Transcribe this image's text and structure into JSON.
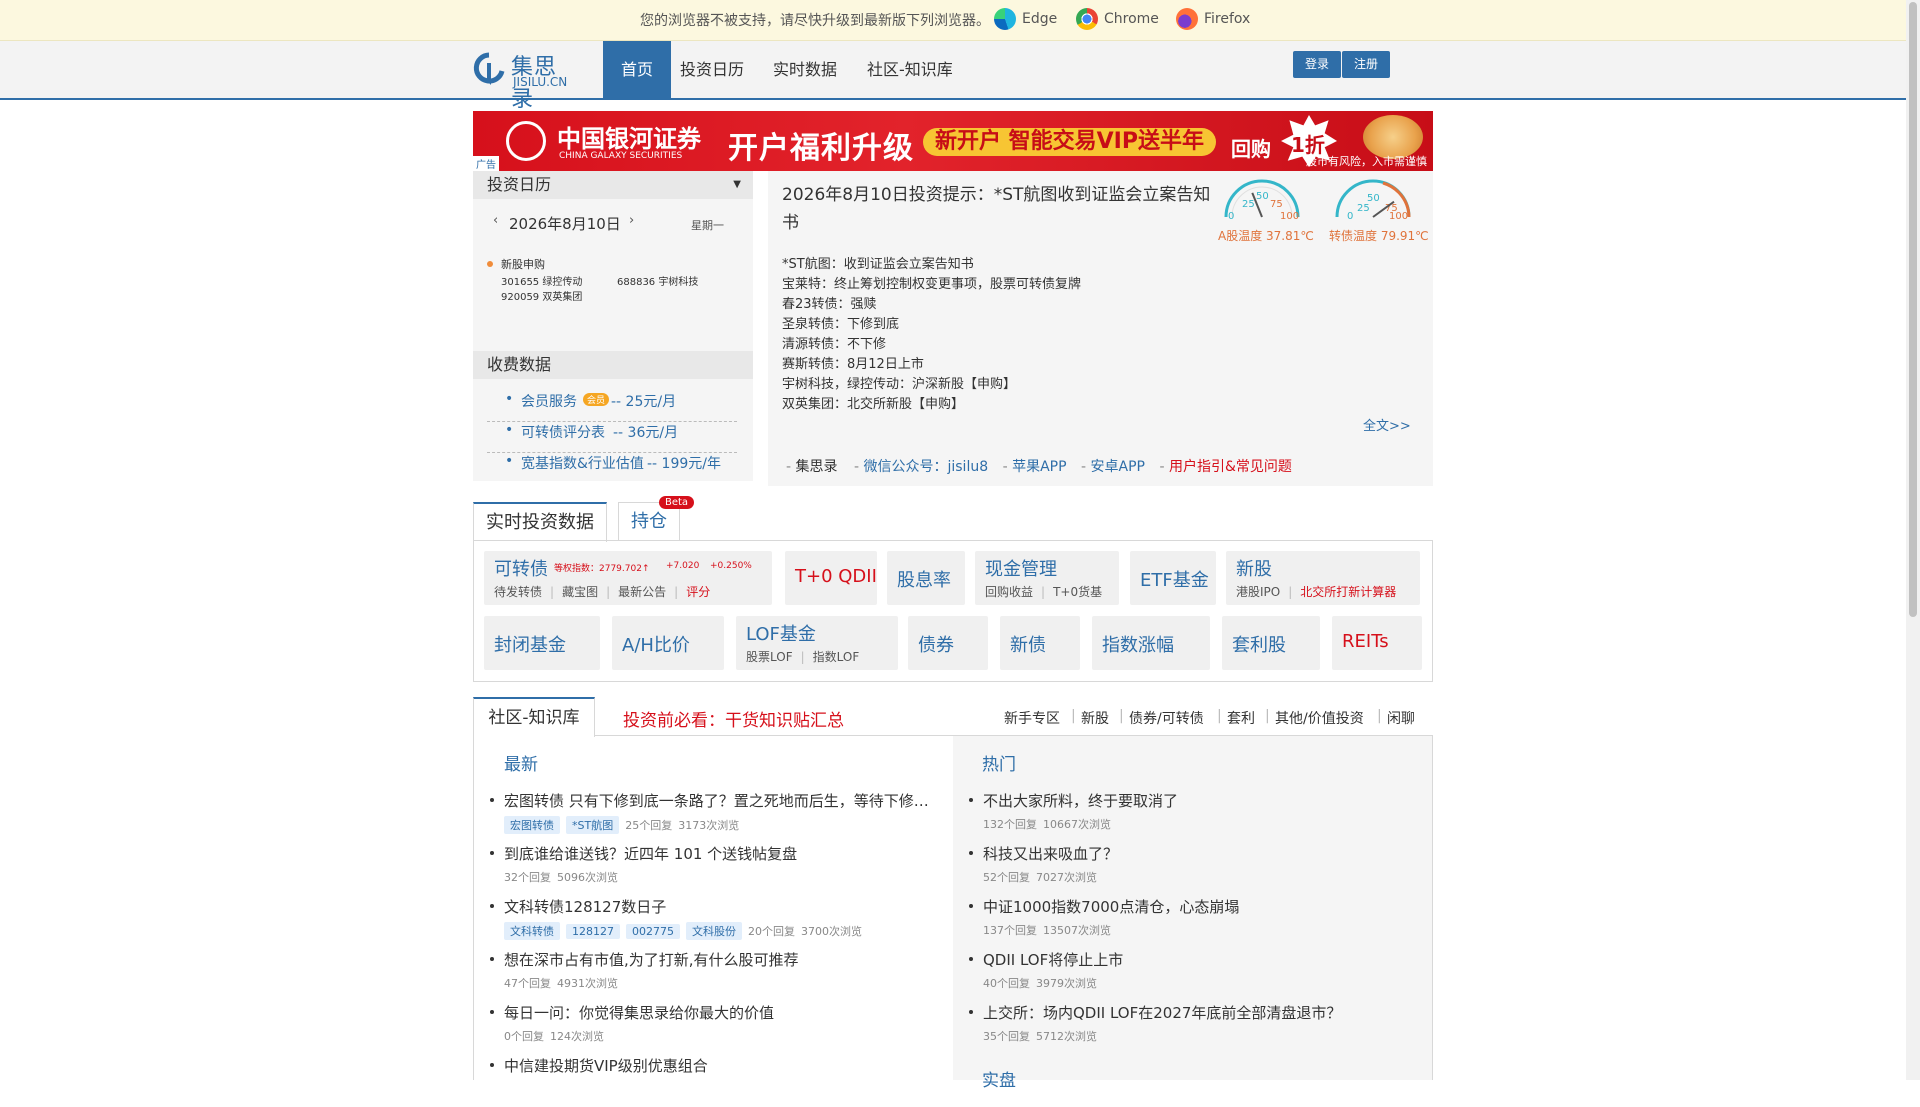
{
  "warning": {
    "message": "您的浏览器不被支持，请尽快升级到最新版下列浏览器。",
    "browsers": [
      "Edge",
      "Chrome",
      "Firefox"
    ]
  },
  "nav": {
    "logo_cn": "集思录",
    "logo_en": "JISILU.CN",
    "items": [
      "首页",
      "投资日历",
      "实时数据",
      "社区-知识库"
    ],
    "login": "登录",
    "register": "注册"
  },
  "banner": {
    "brand": "中国银河证券",
    "brand_en": "CHINA GALAXY SECURITIES",
    "slogan": "开户福利升级",
    "pill": "新开户 智能交易VIP送半年",
    "buyback": "回购",
    "burst": "1折",
    "risk": "股市有风险，入市需谨慎",
    "ad_label": "广告"
  },
  "calendar": {
    "title": "投资日历",
    "date": "2026年8月10日",
    "weekday": "星期一",
    "event_type": "新股申购",
    "stocks": [
      "301655 绿控传动",
      "688836 宇树科技",
      "920059 双英集团"
    ]
  },
  "paid": {
    "title": "收费数据",
    "items": [
      {
        "label": "会员服务",
        "badge": "会员",
        "price": "-- 25元/月"
      },
      {
        "label": "可转债评分表",
        "price": "-- 36元/月"
      },
      {
        "label": "宽基指数&行业估值",
        "price": "-- 199元/年"
      }
    ]
  },
  "tip": {
    "heading": "2026年8月10日投资提示：*ST航图收到证监会立案告知书",
    "lines": [
      "*ST航图：收到证监会立案告知书",
      "宝莱特：终止筹划控制权变更事项，股票可转债复牌",
      "春23转债：强赎",
      "圣泉转债：下修到底",
      "清源转债：不下修",
      "赛斯转债：8月12日上市",
      "宇树科技，绿控传动：沪深新股【申购】",
      "双英集团：北交所新股【申购】"
    ],
    "more": "全文>>",
    "gauges": [
      {
        "label": "A股温度 37.81℃",
        "value": 37.81,
        "ticks": [
          "0",
          "25",
          "50",
          "75",
          "100"
        ]
      },
      {
        "label": "转债温度 79.91℃",
        "value": 79.91,
        "ticks": [
          "0",
          "25",
          "50",
          "75",
          "100"
        ]
      }
    ],
    "links": [
      "集思录",
      "微信公众号：jisilu8",
      "苹果APP",
      "安卓APP",
      "用户指引&常见问题"
    ]
  },
  "realtime": {
    "tab_active": "实时投资数据",
    "tab2": "持仓",
    "tab2_badge": "Beta",
    "convertible": {
      "title": "可转债",
      "index_label": "等权指数：2779.702↑",
      "change": "+7.020",
      "pct": "+0.250%",
      "subs": [
        "待发转债",
        "藏宝图",
        "最新公告",
        "评分"
      ]
    },
    "qdii": "T+0 QDII",
    "dividend": "股息率",
    "cash": {
      "title": "现金管理",
      "subs": [
        "回购收益",
        "T+0货基"
      ]
    },
    "etf": "ETF基金",
    "ipo": {
      "title": "新股",
      "subs": [
        "港股IPO",
        "北交所打新计算器"
      ]
    },
    "row2": [
      "封闭基金",
      "A/H比价",
      "债券",
      "新债",
      "指数涨幅",
      "套利股",
      "REITs"
    ],
    "lof": {
      "title": "LOF基金",
      "subs": [
        "股票LOF",
        "指数LOF"
      ]
    }
  },
  "community": {
    "tab": "社区-知识库",
    "notice": "投资前必看：干货知识贴汇总",
    "categories": [
      "新手专区",
      "新股",
      "债券/可转债",
      "套利",
      "其他/价值投资",
      "闲聊"
    ],
    "latest_title": "最新",
    "latest": [
      {
        "title": "宏图转债 只有下修到底一条路了？置之死地而后生，等待下修…",
        "tags": [
          "宏图转债",
          "*ST航图"
        ],
        "meta": [
          "25个回复",
          "3173次浏览"
        ]
      },
      {
        "title": "到底谁给谁送钱？近四年 101 个送钱帖复盘",
        "tags": [],
        "meta": [
          "32个回复",
          "5096次浏览"
        ]
      },
      {
        "title": "文科转债128127数日子",
        "tags": [
          "文科转债",
          "128127",
          "002775",
          "文科股份"
        ],
        "meta": [
          "20个回复",
          "3700次浏览"
        ]
      },
      {
        "title": "想在深市占有市值,为了打新,有什么股可推荐",
        "tags": [],
        "meta": [
          "47个回复",
          "4931次浏览"
        ]
      },
      {
        "title": "每日一问：你觉得集思录给你最大的价值",
        "tags": [],
        "meta": [
          "0个回复",
          "124次浏览"
        ]
      },
      {
        "title": "中信建投期货VIP级别优惠组合",
        "tags": [],
        "meta": []
      }
    ],
    "hot_title": "热门",
    "hot": [
      {
        "title": "不出大家所料，终于要取消了",
        "meta": [
          "132个回复",
          "10667次浏览"
        ]
      },
      {
        "title": "科技又出来吸血了？",
        "meta": [
          "52个回复",
          "7027次浏览"
        ]
      },
      {
        "title": "中证1000指数7000点清仓，心态崩塌",
        "meta": [
          "137个回复",
          "13507次浏览"
        ]
      },
      {
        "title": "QDII LOF将停止上市",
        "meta": [
          "40个回复",
          "3979次浏览"
        ]
      },
      {
        "title": "上交所：场内QDII LOF在2027年底前全部清盘退市？",
        "meta": [
          "35个回复",
          "5712次浏览"
        ]
      }
    ],
    "next_title": "实盘"
  }
}
